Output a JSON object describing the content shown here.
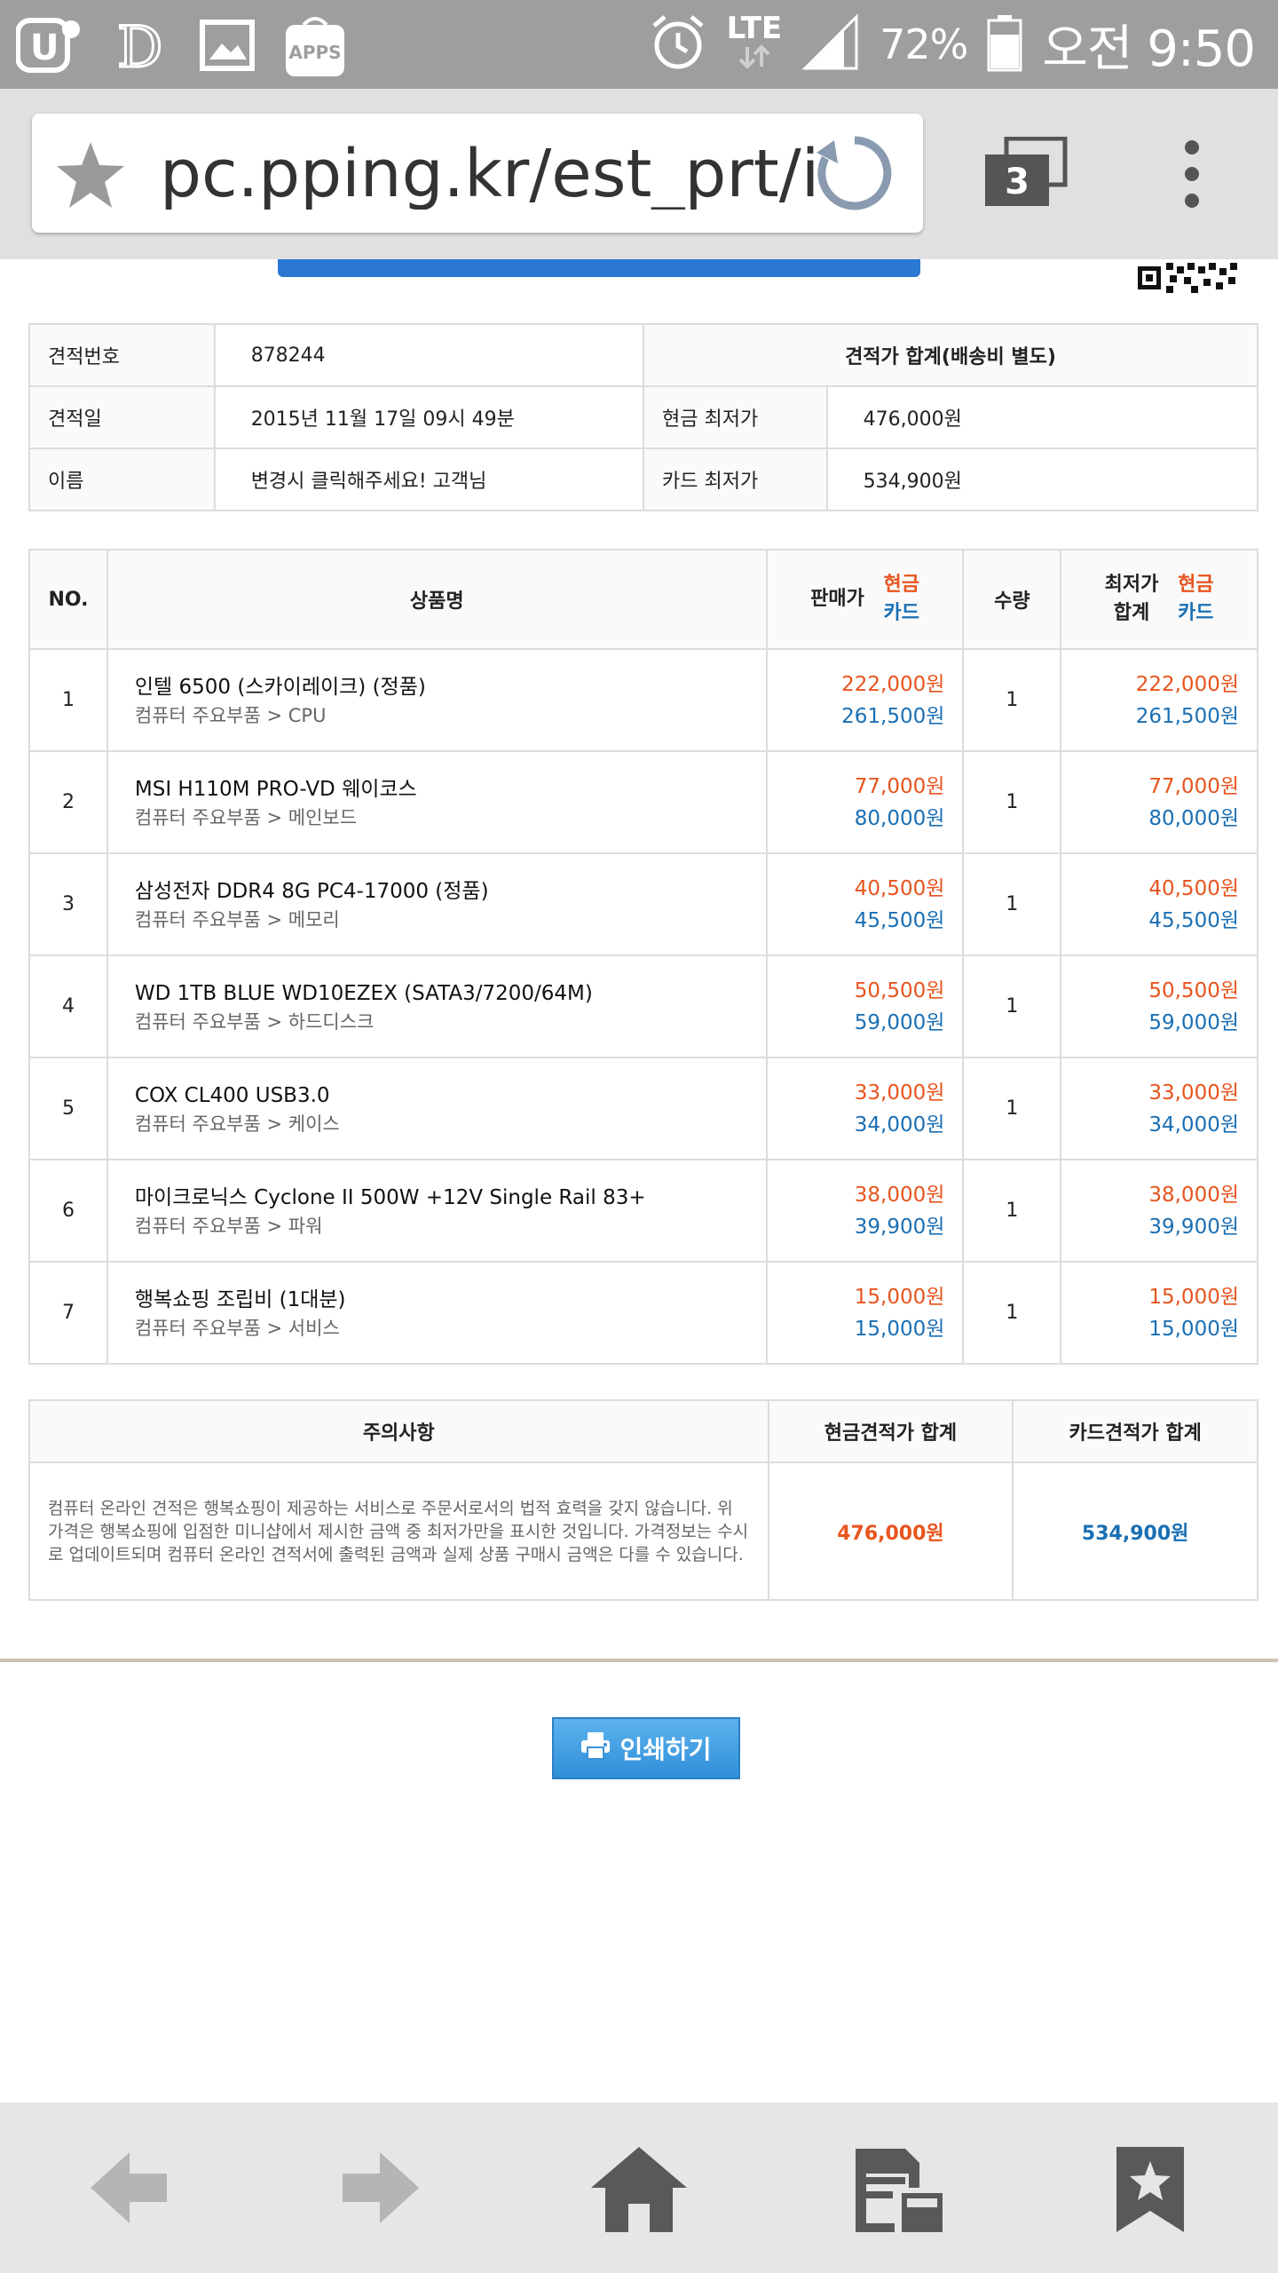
{
  "status_bar": {
    "apps_label": "APPS",
    "network": "LTE",
    "battery": "72%",
    "time": "오전 9:50"
  },
  "browser": {
    "url": "pc.pping.kr/est_prt/index",
    "tab_count": "3"
  },
  "estimate": {
    "number_label": "견적번호",
    "number": "878244",
    "date_label": "견적일",
    "date": "2015년 11월 17일 09시 49분",
    "name_label": "이름",
    "name": "변경시 클릭해주세요! 고객님",
    "total_header": "견적가 합계(배송비 별도)",
    "cash_label": "현금 최저가",
    "cash_total": "476,000원",
    "card_label": "카드 최저가",
    "card_total": "534,900원"
  },
  "items_table": {
    "headers": {
      "no": "NO.",
      "product": "상품명",
      "price": "판매가",
      "cash": "현금",
      "card": "카드",
      "qty": "수량",
      "lowest_line1": "최저가",
      "lowest_line2": "합계"
    },
    "rows": [
      {
        "no": "1",
        "name": "인텔 6500 (스카이레이크) (정품)",
        "category": "컴퓨터 주요부품 > CPU",
        "cash": "222,000원",
        "card": "261,500원",
        "qty": "1",
        "sum_cash": "222,000원",
        "sum_card": "261,500원"
      },
      {
        "no": "2",
        "name": "MSI H110M PRO-VD 웨이코스",
        "category": "컴퓨터 주요부품 > 메인보드",
        "cash": "77,000원",
        "card": "80,000원",
        "qty": "1",
        "sum_cash": "77,000원",
        "sum_card": "80,000원"
      },
      {
        "no": "3",
        "name": "삼성전자 DDR4 8G PC4-17000 (정품)",
        "category": "컴퓨터 주요부품 > 메모리",
        "cash": "40,500원",
        "card": "45,500원",
        "qty": "1",
        "sum_cash": "40,500원",
        "sum_card": "45,500원"
      },
      {
        "no": "4",
        "name": "WD 1TB BLUE WD10EZEX (SATA3/7200/64M)",
        "category": "컴퓨터 주요부품 > 하드디스크",
        "cash": "50,500원",
        "card": "59,000원",
        "qty": "1",
        "sum_cash": "50,500원",
        "sum_card": "59,000원"
      },
      {
        "no": "5",
        "name": "COX CL400 USB3.0",
        "category": "컴퓨터 주요부품 > 케이스",
        "cash": "33,000원",
        "card": "34,000원",
        "qty": "1",
        "sum_cash": "33,000원",
        "sum_card": "34,000원"
      },
      {
        "no": "6",
        "name": "마이크로닉스 Cyclone II 500W +12V Single Rail 83+",
        "category": "컴퓨터 주요부품 > 파워",
        "cash": "38,000원",
        "card": "39,900원",
        "qty": "1",
        "sum_cash": "38,000원",
        "sum_card": "39,900원"
      },
      {
        "no": "7",
        "name": "행복쇼핑 조립비 (1대분)",
        "category": "컴퓨터 주요부품 > 서비스",
        "cash": "15,000원",
        "card": "15,000원",
        "qty": "1",
        "sum_cash": "15,000원",
        "sum_card": "15,000원"
      }
    ]
  },
  "notice": {
    "header": "주의사항",
    "cash_header": "현금견적가 합계",
    "card_header": "카드견적가 합계",
    "text": "컴퓨터 온라인 견적은 행복쇼핑이 제공하는 서비스로 주문서로서의 법적 효력을 갖지 않습니다. 위 가격은 행복쇼핑에 입점한 미니샵에서 제시한 금액 중 최저가만을 표시한 것입니다. 가격정보는 수시로 업데이트되며 컴퓨터 온라인 견적서에 출력된 금액과 실제 상품 구매시 금액은 다를 수 있습니다.",
    "cash_total": "476,000원",
    "card_total": "534,900원"
  },
  "print_button": {
    "label": "인쇄하기"
  },
  "colors": {
    "cash": "#e8541e",
    "card": "#1a6fb4",
    "status_bar": "#9e9e9e",
    "toolbar": "#e0e0e0"
  }
}
